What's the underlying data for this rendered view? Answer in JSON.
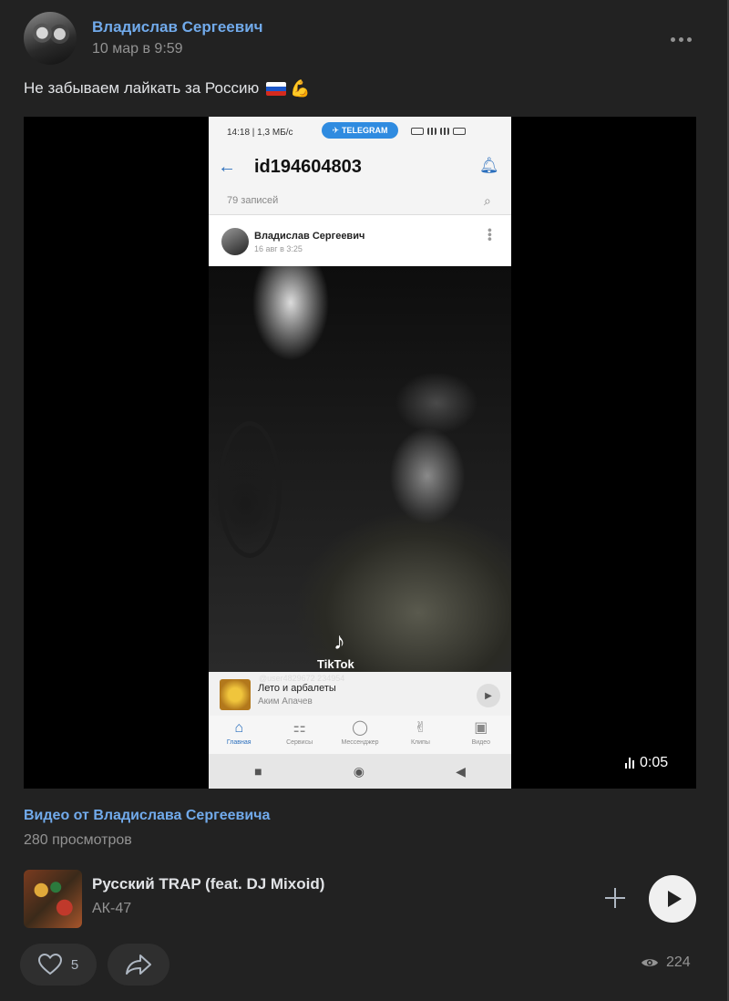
{
  "post": {
    "author": "Владислав Сергеевич",
    "date": "10 мар в 9:59",
    "text": "Не забываем лайкать за Россию",
    "emoji": "💪"
  },
  "video": {
    "duration": "0:05",
    "screen": {
      "status_time": "14:18 | 1,3 МБ/с",
      "telegram_pill": "TELEGRAM",
      "profile_id": "id194604803",
      "records": "79 записей",
      "inner_author": "Владислав Сергеевич",
      "inner_date": "16 авг в 3:25",
      "tiktok_label": "TikTok",
      "tiktok_user": "@user4829672 234954",
      "track_title": "Лето и арбалеты",
      "track_artist": "Аким Апачев",
      "tabs": [
        {
          "label": "Главная",
          "icon": "home-icon"
        },
        {
          "label": "Сервисы",
          "icon": "services-icon"
        },
        {
          "label": "Мессенджер",
          "icon": "messenger-icon"
        },
        {
          "label": "Клипы",
          "icon": "clips-icon"
        },
        {
          "label": "Видео",
          "icon": "video-icon"
        }
      ]
    }
  },
  "video_link": "Видео от Владислава Сергеевича",
  "video_views": "280 просмотров",
  "audio": {
    "title": "Русский TRAP (feat. DJ Mixoid)",
    "artist": "АК-47"
  },
  "footer": {
    "likes": "5",
    "views": "224"
  },
  "colors": {
    "background": "#222222",
    "link": "#71aaeb",
    "muted": "#939393",
    "button_bg": "#2f2f2f"
  }
}
